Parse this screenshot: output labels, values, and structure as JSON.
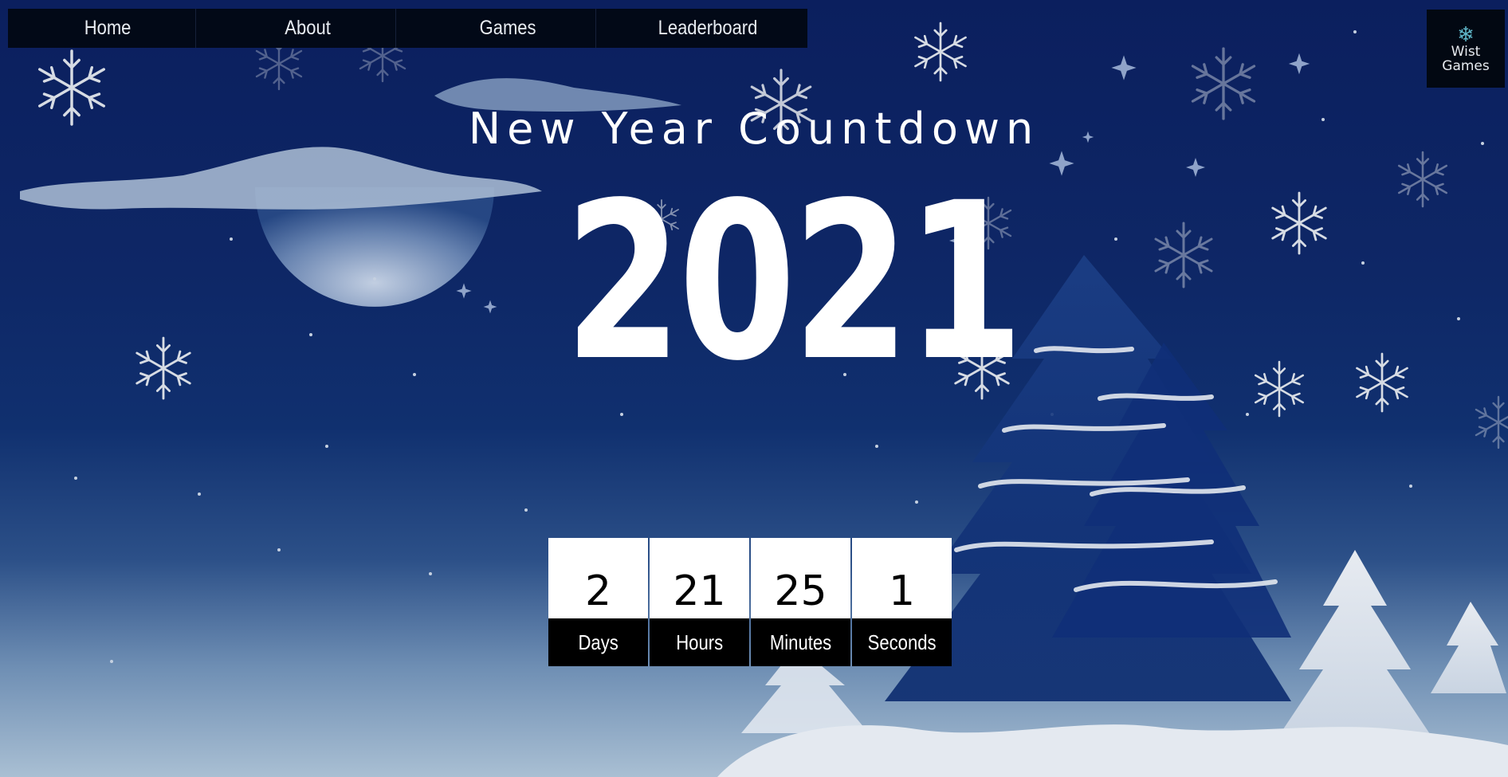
{
  "nav": {
    "items": [
      {
        "label": "Home"
      },
      {
        "label": "About"
      },
      {
        "label": "Games"
      },
      {
        "label": "Leaderboard"
      }
    ]
  },
  "logo": {
    "icon": "snowflake-icon",
    "text": "Wist\nGames"
  },
  "hero": {
    "title": "New Year Countdown",
    "year": "2021"
  },
  "countdown": [
    {
      "value": "2",
      "unit": "Days"
    },
    {
      "value": "21",
      "unit": "Hours"
    },
    {
      "value": "25",
      "unit": "Minutes"
    },
    {
      "value": "1",
      "unit": "Seconds"
    }
  ],
  "colors": {
    "sky_top": "#0b1f5e",
    "sky_bottom": "#a9bfd3",
    "nav_bg": "#020917",
    "snow": "#d9dee6"
  }
}
